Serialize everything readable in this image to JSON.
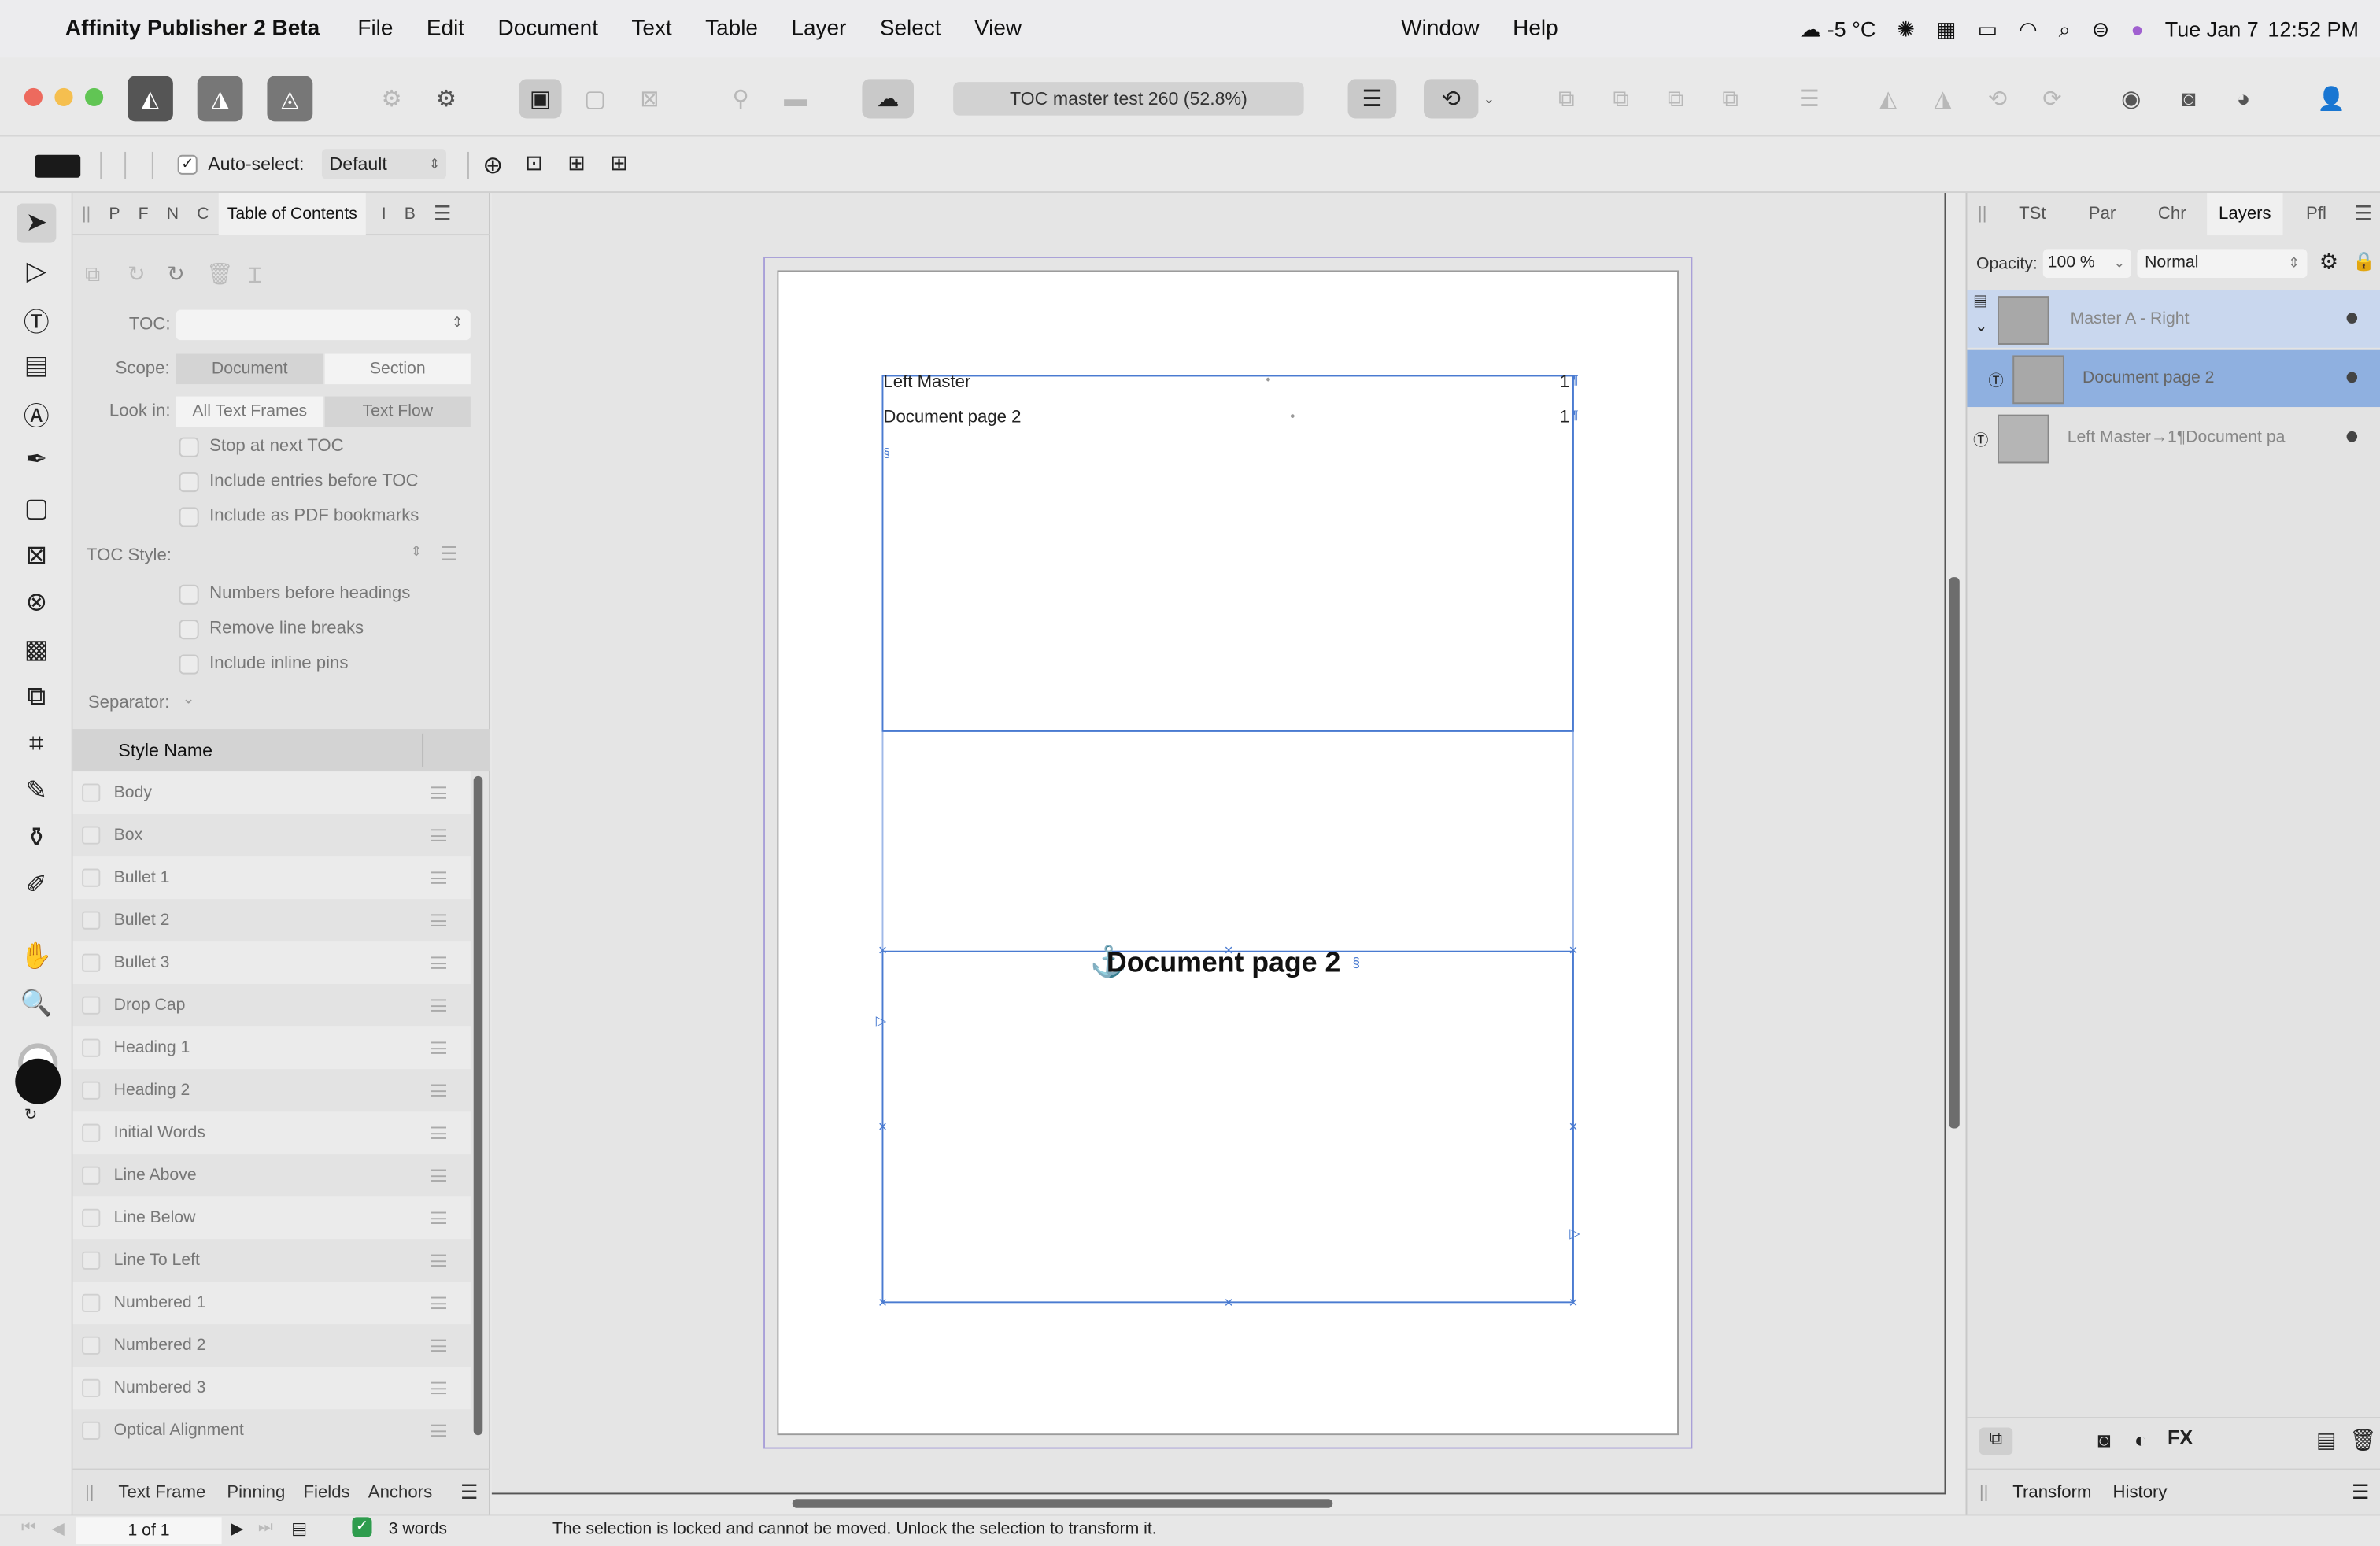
{
  "menubar": {
    "apple_icon": "apple-logo",
    "app_name": "Affinity Publisher 2 Beta",
    "menus": [
      "File",
      "Edit",
      "Document",
      "Text",
      "Table",
      "Layer",
      "Select",
      "View"
    ],
    "menus_right": [
      "Window",
      "Help"
    ],
    "weather": "-5 °C",
    "date": "Tue Jan 7",
    "time": "12:52 PM"
  },
  "toolbar": {
    "document_title": "TOC master test 260 (52.8%)"
  },
  "context_toolbar": {
    "auto_select_label": "Auto-select:",
    "auto_select_checked": true,
    "auto_select_value": "Default"
  },
  "left_panel": {
    "tabs": [
      "P",
      "F",
      "N",
      "C",
      "Table of Contents",
      "I",
      "B"
    ],
    "active_tab": "Table of Contents",
    "toc_label": "TOC:",
    "toc_value": "",
    "scope_label": "Scope:",
    "scope_options": [
      "Document",
      "Section"
    ],
    "look_in_label": "Look in:",
    "look_in_options": [
      "All Text Frames",
      "Text Flow"
    ],
    "options1": [
      "Stop at next TOC",
      "Include entries before TOC",
      "Include as PDF bookmarks"
    ],
    "toc_style_label": "TOC Style:",
    "options2": [
      "Numbers before headings",
      "Remove line breaks",
      "Include inline pins"
    ],
    "separator_label": "Separator:",
    "style_name_header": "Style Name",
    "styles": [
      "Body",
      "Box",
      "Bullet 1",
      "Bullet 2",
      "Bullet 3",
      "Drop Cap",
      "Heading 1",
      "Heading 2",
      "Initial Words",
      "Line Above",
      "Line Below",
      "Line To Left",
      "Numbered 1",
      "Numbered 2",
      "Numbered 3",
      "Optical Alignment"
    ],
    "bottom_tabs": [
      "Text Frame",
      "Pinning",
      "Fields",
      "Anchors"
    ]
  },
  "canvas": {
    "toc_entries": [
      {
        "text": "Left Master",
        "page": "1"
      },
      {
        "text": "Document page 2",
        "page": "1"
      }
    ],
    "heading_text": "Document page 2"
  },
  "right_panel": {
    "tabs": [
      "TSt",
      "Par",
      "Chr",
      "Layers",
      "Pfl"
    ],
    "active_tab": "Layers",
    "opacity_label": "Opacity:",
    "opacity_value": "100 %",
    "blend_mode": "Normal",
    "layers": [
      {
        "name": "Master A - Right"
      },
      {
        "name": "Document page 2"
      },
      {
        "name": "Left Master→1¶Document pa"
      }
    ],
    "bottom_tabs": [
      "Transform",
      "History"
    ]
  },
  "statusbar": {
    "page_indicator": "1 of 1",
    "word_count": "3 words",
    "message": "The selection is locked and cannot be moved. Unlock the selection to transform it."
  },
  "colors": {
    "selection_blue": "#4a7bd1",
    "layer_selected": "#8fb0e0",
    "layer_highlight": "#c9d7ee"
  }
}
